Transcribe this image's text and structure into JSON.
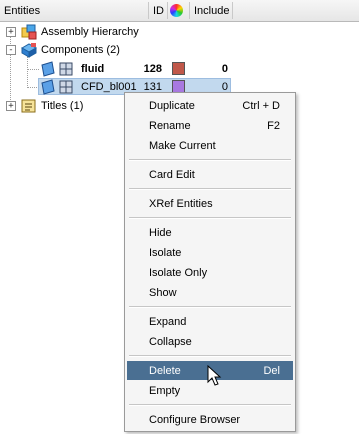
{
  "header": {
    "entities": "Entities",
    "id": "ID",
    "color_icon": "color-wheel-icon",
    "include": "Include"
  },
  "tree": {
    "assembly": {
      "label": "Assembly Hierarchy",
      "expander": "+"
    },
    "components": {
      "label": "Components (2)",
      "expander": "-"
    },
    "fluid": {
      "label": "fluid",
      "id": "128",
      "include": "0",
      "color": "#c0584a"
    },
    "cfd": {
      "label": "CFD_bl001",
      "id": "131",
      "include": "0",
      "color": "#a879e0"
    },
    "titles": {
      "label": "Titles (1)",
      "expander": "+"
    }
  },
  "menu": {
    "items": [
      {
        "label": "Duplicate",
        "shortcut": "Ctrl + D"
      },
      {
        "label": "Rename",
        "shortcut": "F2"
      },
      {
        "label": "Make Current",
        "shortcut": ""
      },
      {
        "label": "Card Edit",
        "shortcut": ""
      },
      {
        "label": "XRef Entities",
        "shortcut": ""
      },
      {
        "label": "Hide",
        "shortcut": ""
      },
      {
        "label": "Isolate",
        "shortcut": ""
      },
      {
        "label": "Isolate Only",
        "shortcut": ""
      },
      {
        "label": "Show",
        "shortcut": ""
      },
      {
        "label": "Expand",
        "shortcut": ""
      },
      {
        "label": "Collapse",
        "shortcut": ""
      },
      {
        "label": "Delete",
        "shortcut": "Del"
      },
      {
        "label": "Empty",
        "shortcut": ""
      },
      {
        "label": "Configure Browser",
        "shortcut": ""
      }
    ],
    "highlighted": "Delete"
  }
}
